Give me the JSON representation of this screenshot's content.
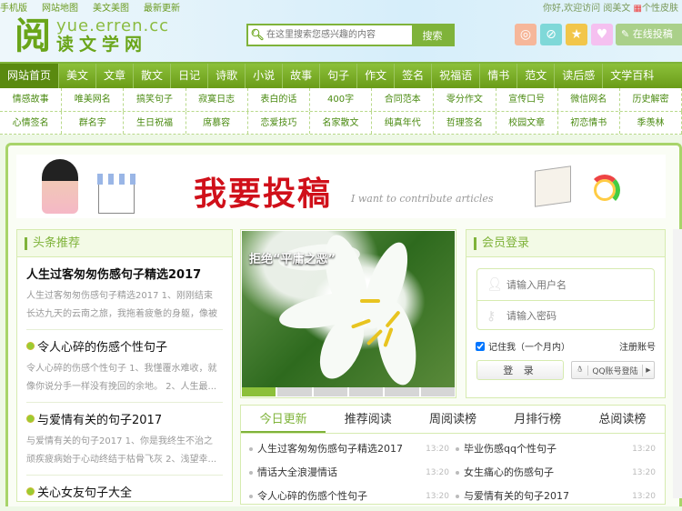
{
  "top": {
    "links": [
      "手机版",
      "网站地图",
      "美文美图",
      "最新更新"
    ],
    "greeting": "你好,欢迎访问 阅美文",
    "skin": "个性皮肤"
  },
  "logo": {
    "char": "阅",
    "domain": "yue.erren.cc",
    "name": "读文学网"
  },
  "search": {
    "placeholder": "在这里搜索您感兴趣的内容",
    "button": "搜索"
  },
  "header": {
    "submit": "在线投稿",
    "social": [
      "weibo-icon",
      "tencent-weibo-icon",
      "qzone-icon",
      "heart-icon"
    ]
  },
  "nav": [
    "网站首页",
    "美文",
    "文章",
    "散文",
    "日记",
    "诗歌",
    "小说",
    "故事",
    "句子",
    "作文",
    "签名",
    "祝福语",
    "情书",
    "范文",
    "读后感",
    "文学百科"
  ],
  "subnav": [
    [
      "情感故事",
      "唯美网名",
      "搞笑句子",
      "寂寞日志",
      "表白的话",
      "400字",
      "合同范本",
      "零分作文",
      "宣传口号",
      "微信网名",
      "历史解密"
    ],
    [
      "心情签名",
      "群名字",
      "生日祝福",
      "席慕容",
      "恋爱技巧",
      "名家散文",
      "纯真年代",
      "哲理签名",
      "校园文章",
      "初恋情书",
      "季羡林"
    ]
  ],
  "banner": {
    "title": "我要投稿",
    "subtitle": "I want to contribute articles"
  },
  "headline": {
    "title": "头条推荐",
    "items": [
      {
        "title": "人生过客匆匆伤感句子精选2017",
        "lines": [
          "人生过客匆匆伤感句子精选2017 1、刚刚结束",
          "长达九天的云南之旅，我拖着疲惫的身躯，像被"
        ]
      },
      {
        "title": "令人心碎的伤感个性句子",
        "lines": [
          "令人心碎的伤感个性句子 1、我懂覆水难收，就",
          "像你说分手一样没有挽回的余地。 2、人生最..."
        ]
      },
      {
        "title": "与爱情有关的句子2017",
        "lines": [
          "与爱情有关的句子2017 1、你是我终生不治之",
          "顽疾疲病始于心动终结于枯骨飞灰 2、浅望幸..."
        ]
      },
      {
        "title": "关心女友句子大全",
        "lines": []
      }
    ]
  },
  "slide": {
    "caption": "拒绝“平庸之恶”",
    "active": 1,
    "count": 6
  },
  "login": {
    "title": "会员登录",
    "user_placeholder": "请输入用户名",
    "pass_placeholder": "请输入密码",
    "remember": "记住我（一个月内）",
    "register": "注册账号",
    "login": "登 录",
    "qq": "QQ账号登陆"
  },
  "tabs": {
    "labels": [
      "今日更新",
      "推荐阅读",
      "周阅读榜",
      "月排行榜",
      "总阅读榜"
    ],
    "items": [
      {
        "title": "人生过客匆匆伤感句子精选2017",
        "time": "13:20"
      },
      {
        "title": "毕业伤感qq个性句子",
        "time": "13:20"
      },
      {
        "title": "情话大全浪漫情话",
        "time": "13:20"
      },
      {
        "title": "女生痛心的伤感句子",
        "time": "13:20"
      },
      {
        "title": "令人心碎的伤感个性句子",
        "time": "13:20"
      },
      {
        "title": "与爱情有关的句子2017",
        "time": "13:20"
      }
    ]
  }
}
